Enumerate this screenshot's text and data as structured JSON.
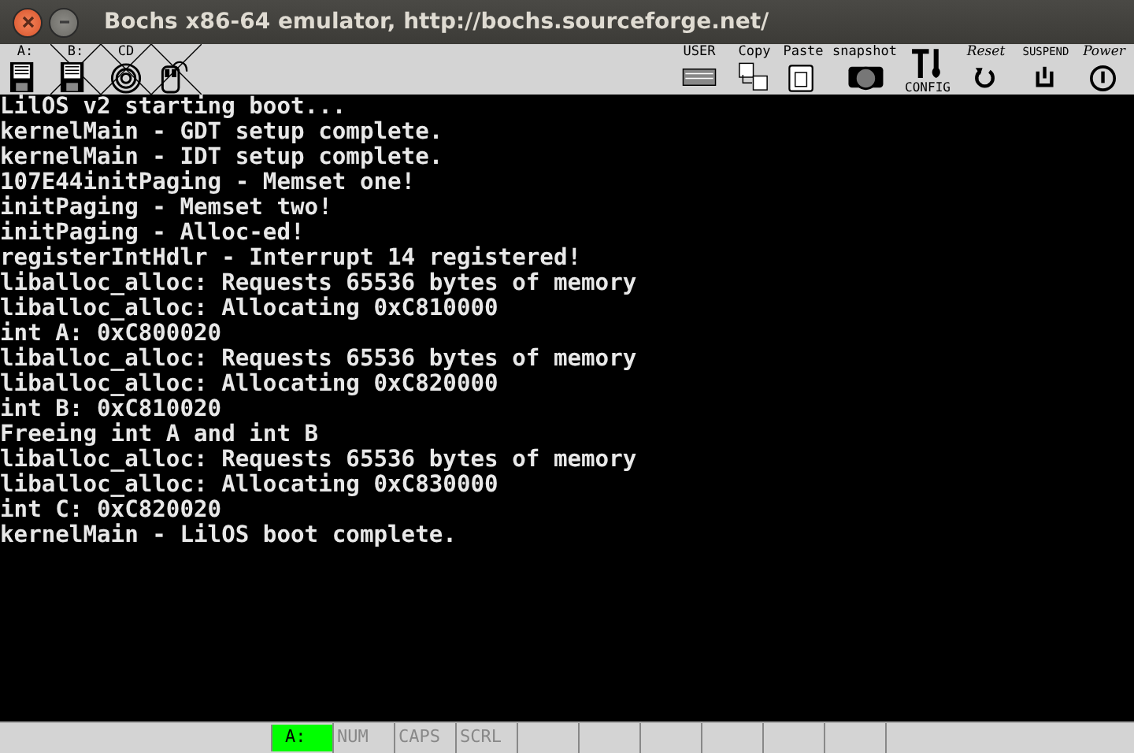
{
  "window": {
    "title": "Bochs x86-64 emulator, http://bochs.sourceforge.net/"
  },
  "toolbar_left": [
    {
      "kind": "floppy",
      "label": "A:",
      "disabled": false
    },
    {
      "kind": "floppy",
      "label": "B:",
      "disabled": true
    },
    {
      "kind": "cdrom",
      "label": "CD",
      "disabled": true
    },
    {
      "kind": "mouse",
      "disabled": true
    }
  ],
  "toolbar_right": [
    {
      "kind": "keyboard",
      "label": "USER"
    },
    {
      "kind": "copy",
      "label": "Copy"
    },
    {
      "kind": "paste",
      "label": "Paste"
    },
    {
      "kind": "snapshot",
      "label": "snapshot"
    },
    {
      "kind": "config",
      "label": "CONFIG"
    },
    {
      "kind": "reset",
      "label": "Reset"
    },
    {
      "kind": "suspend",
      "label": "SUSPEND"
    },
    {
      "kind": "power",
      "label": "Power"
    }
  ],
  "console_lines": [
    "LilOS v2 starting boot...",
    "kernelMain - GDT setup complete.",
    "kernelMain - IDT setup complete.",
    "107E44initPaging - Memset one!",
    "initPaging - Memset two!",
    "initPaging - Alloc-ed!",
    "registerIntHdlr - Interrupt 14 registered!",
    "liballoc_alloc: Requests 65536 bytes of memory",
    "liballoc_alloc: Allocating 0xC810000",
    "int A: 0xC800020",
    "liballoc_alloc: Requests 65536 bytes of memory",
    "liballoc_alloc: Allocating 0xC820000",
    "int B: 0xC810020",
    "Freeing int A and int B",
    "liballoc_alloc: Requests 65536 bytes of memory",
    "liballoc_alloc: Allocating 0xC830000",
    "int C: 0xC820020",
    "kernelMain - LilOS boot complete."
  ],
  "status_bar": [
    {
      "label": "A:",
      "on": true
    },
    {
      "label": "NUM",
      "on": false
    },
    {
      "label": "CAPS",
      "on": false
    },
    {
      "label": "SCRL",
      "on": false
    }
  ]
}
